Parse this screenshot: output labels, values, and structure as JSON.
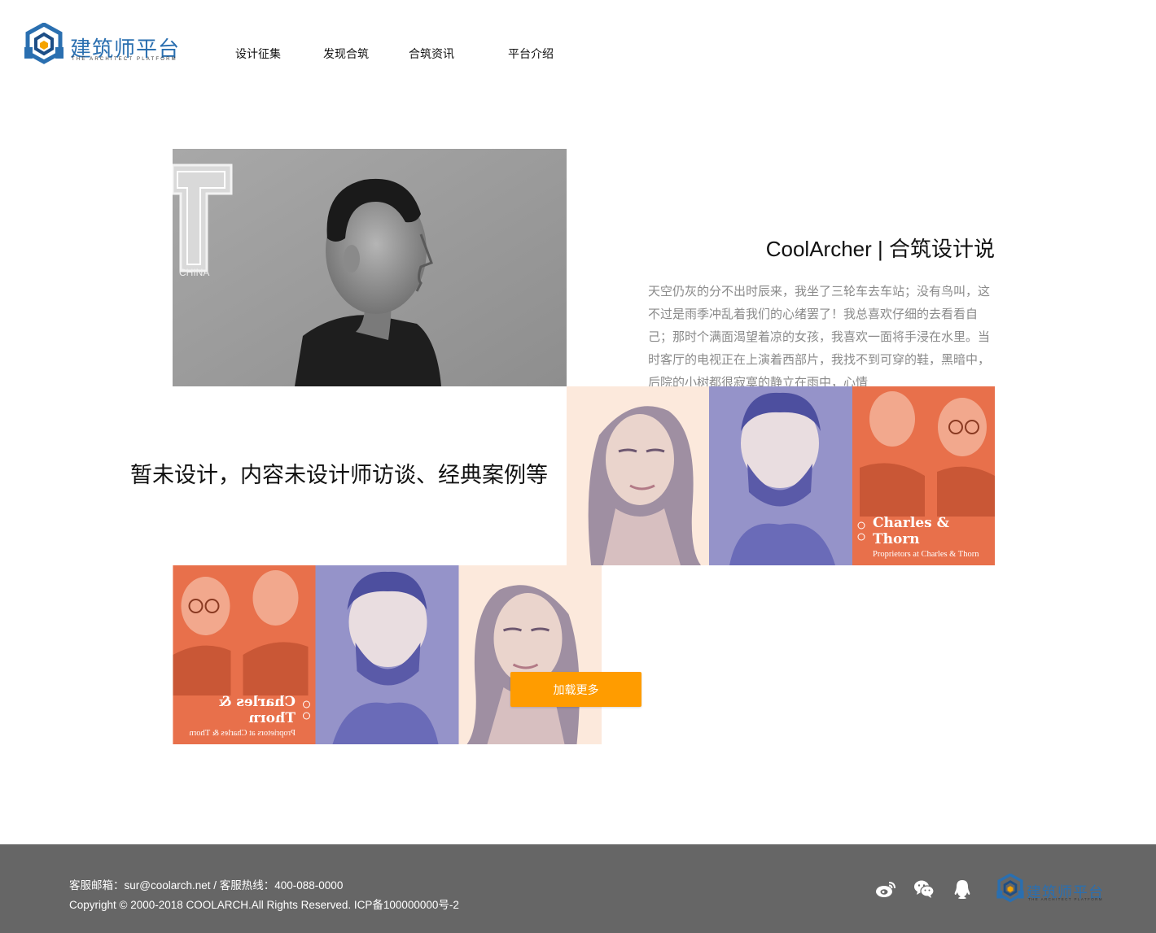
{
  "header": {
    "logo_text": "建筑师平台",
    "logo_subtitle": "THE ARCHITECT PLATFORM",
    "nav": [
      {
        "label": "设计征集"
      },
      {
        "label": "发现合筑"
      },
      {
        "label": "合筑资讯"
      },
      {
        "label": "平台介绍"
      }
    ]
  },
  "feature": {
    "photo_text": "CHINA",
    "title": "CoolArcher | 合筑设计说",
    "excerpt": "天空仍灰的分不出时辰来，我坐了三轮车去车站；没有鸟叫，这不过是雨季冲乱着我们的心绪罢了！我总喜欢仔细的去看看自己；那时个满面渴望着凉的女孩，我喜欢一面将手浸在水里。当时客厅的电视正在上演着西部片，我找不到可穿的鞋，黑暗中，后院的小树都很寂寞的静立在雨中，心情"
  },
  "placeholder_text": "暂未设计，内容未设计师访谈、经典案例等",
  "banners": [
    {
      "brand": "Charles &",
      "brand2": "Thorn",
      "subtitle": "Proprietors at Charles & Thorn"
    },
    {
      "brand": "Charles &",
      "brand2": "Thorn",
      "subtitle": "Proprietors at Charles & Thorn"
    }
  ],
  "load_more_label": "加载更多",
  "footer": {
    "contact": "客服邮箱：sur@coolarch.net / 客服热线：400-088-0000",
    "copyright": "Copyright © 2000-2018 COOLARCH.All Rights Reserved.  ICP备100000000号-2",
    "logo_text": "建筑师平台",
    "logo_subtitle": "THE ARCHITECT PLATFORM",
    "social_icons": [
      "weibo-icon",
      "wechat-icon",
      "qq-icon"
    ]
  },
  "colors": {
    "accent": "#ff9c00",
    "footer_bg": "#666666",
    "brand_blue": "#2a6fb0",
    "banner_orange": "#e8704b",
    "banner_purple": "#6a6bb8",
    "banner_cream": "#fce9dc"
  }
}
